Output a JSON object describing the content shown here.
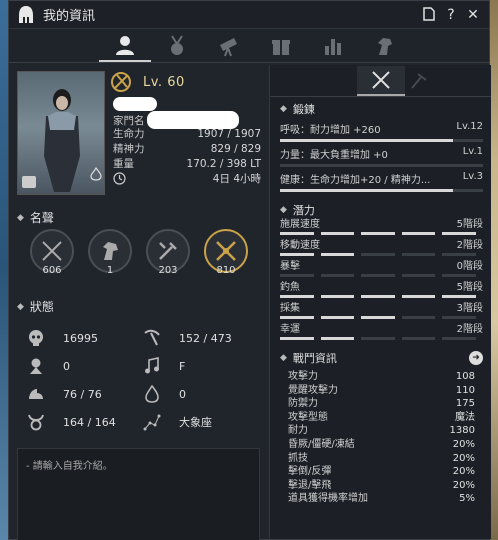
{
  "window": {
    "title": "我的資訊"
  },
  "colors": {
    "accent_gold": "#c9a24a",
    "panel": "#20242b",
    "bar_fill": "#d8d8d8"
  },
  "tabs": [
    {
      "icon": "person-icon",
      "active": true
    },
    {
      "icon": "medal-icon",
      "active": false
    },
    {
      "icon": "telescope-icon",
      "active": false
    },
    {
      "icon": "gift-icon",
      "active": false
    },
    {
      "icon": "bar-chart-icon",
      "active": false
    },
    {
      "icon": "horse-icon",
      "active": false
    }
  ],
  "profile": {
    "level": "Lv. 60",
    "family_label": "家門名",
    "rows": [
      {
        "key": "生命力",
        "value": "1907 / 1907"
      },
      {
        "key": "精神力",
        "value": "829 / 829"
      },
      {
        "key": "重量",
        "value": "170.2 / 398 LT"
      },
      {
        "key": "",
        "value": "4日 4小時"
      }
    ]
  },
  "fame": {
    "title": "名聲",
    "items": [
      {
        "icon": "swords-icon",
        "value": "606",
        "highlight": false
      },
      {
        "icon": "horse-head-icon",
        "value": "1",
        "highlight": false
      },
      {
        "icon": "tools-icon",
        "value": "203",
        "highlight": false
      },
      {
        "icon": "crossed-swords-gold-icon",
        "value": "810",
        "highlight": true
      }
    ]
  },
  "status": {
    "title": "狀態",
    "cells": [
      {
        "icon": "skull-icon",
        "value": "16995"
      },
      {
        "icon": "pickaxe-icon",
        "value": "152 / 473"
      },
      {
        "icon": "karma-icon",
        "value": "0"
      },
      {
        "icon": "music-note-icon",
        "value": "F"
      },
      {
        "icon": "strength-icon",
        "value": "76 / 76"
      },
      {
        "icon": "flame-icon",
        "value": "0"
      },
      {
        "icon": "taurus-icon",
        "value": "164 / 164"
      },
      {
        "icon": "constellation-icon",
        "value": "大象座"
      }
    ]
  },
  "intro": {
    "placeholder": "- 請輸入自我介紹。",
    "pen": "✎"
  },
  "training": {
    "title": "鍛鍊",
    "rows": [
      {
        "label": "呼吸：耐力增加 +260",
        "level": "Lv.12",
        "fill": 0.85
      },
      {
        "label": "力量：最大負重增加 +0",
        "level": "Lv.1",
        "fill": 0.0
      },
      {
        "label": "健康：生命力增加+20 / 精神力...",
        "level": "Lv.3",
        "fill": 0.85
      }
    ]
  },
  "potential": {
    "title": "潛力",
    "rows": [
      {
        "label": "施展速度",
        "value": "5階段",
        "on": 5
      },
      {
        "label": "移動速度",
        "value": "2階段",
        "on": 2
      },
      {
        "label": "暴擊",
        "value": "0階段",
        "on": 0
      },
      {
        "label": "釣魚",
        "value": "5階段",
        "on": 5
      },
      {
        "label": "採集",
        "value": "3階段",
        "on": 3
      },
      {
        "label": "幸運",
        "value": "2階段",
        "on": 2
      }
    ]
  },
  "combat": {
    "title": "戰鬥資訊",
    "rows": [
      {
        "key": "攻擊力",
        "value": "108"
      },
      {
        "key": "覺醒攻擊力",
        "value": "110"
      },
      {
        "key": "防禦力",
        "value": "175"
      },
      {
        "key": "攻擊型態",
        "value": "魔法"
      },
      {
        "key": "耐力",
        "value": "1380"
      },
      {
        "key": "昏厥/僵硬/凍結",
        "value": "20%"
      },
      {
        "key": "抓技",
        "value": "20%"
      },
      {
        "key": "擊倒/反彈",
        "value": "20%"
      },
      {
        "key": "擊退/擊飛",
        "value": "20%"
      },
      {
        "key": "道具獲得機率增加",
        "value": "5%"
      }
    ]
  }
}
